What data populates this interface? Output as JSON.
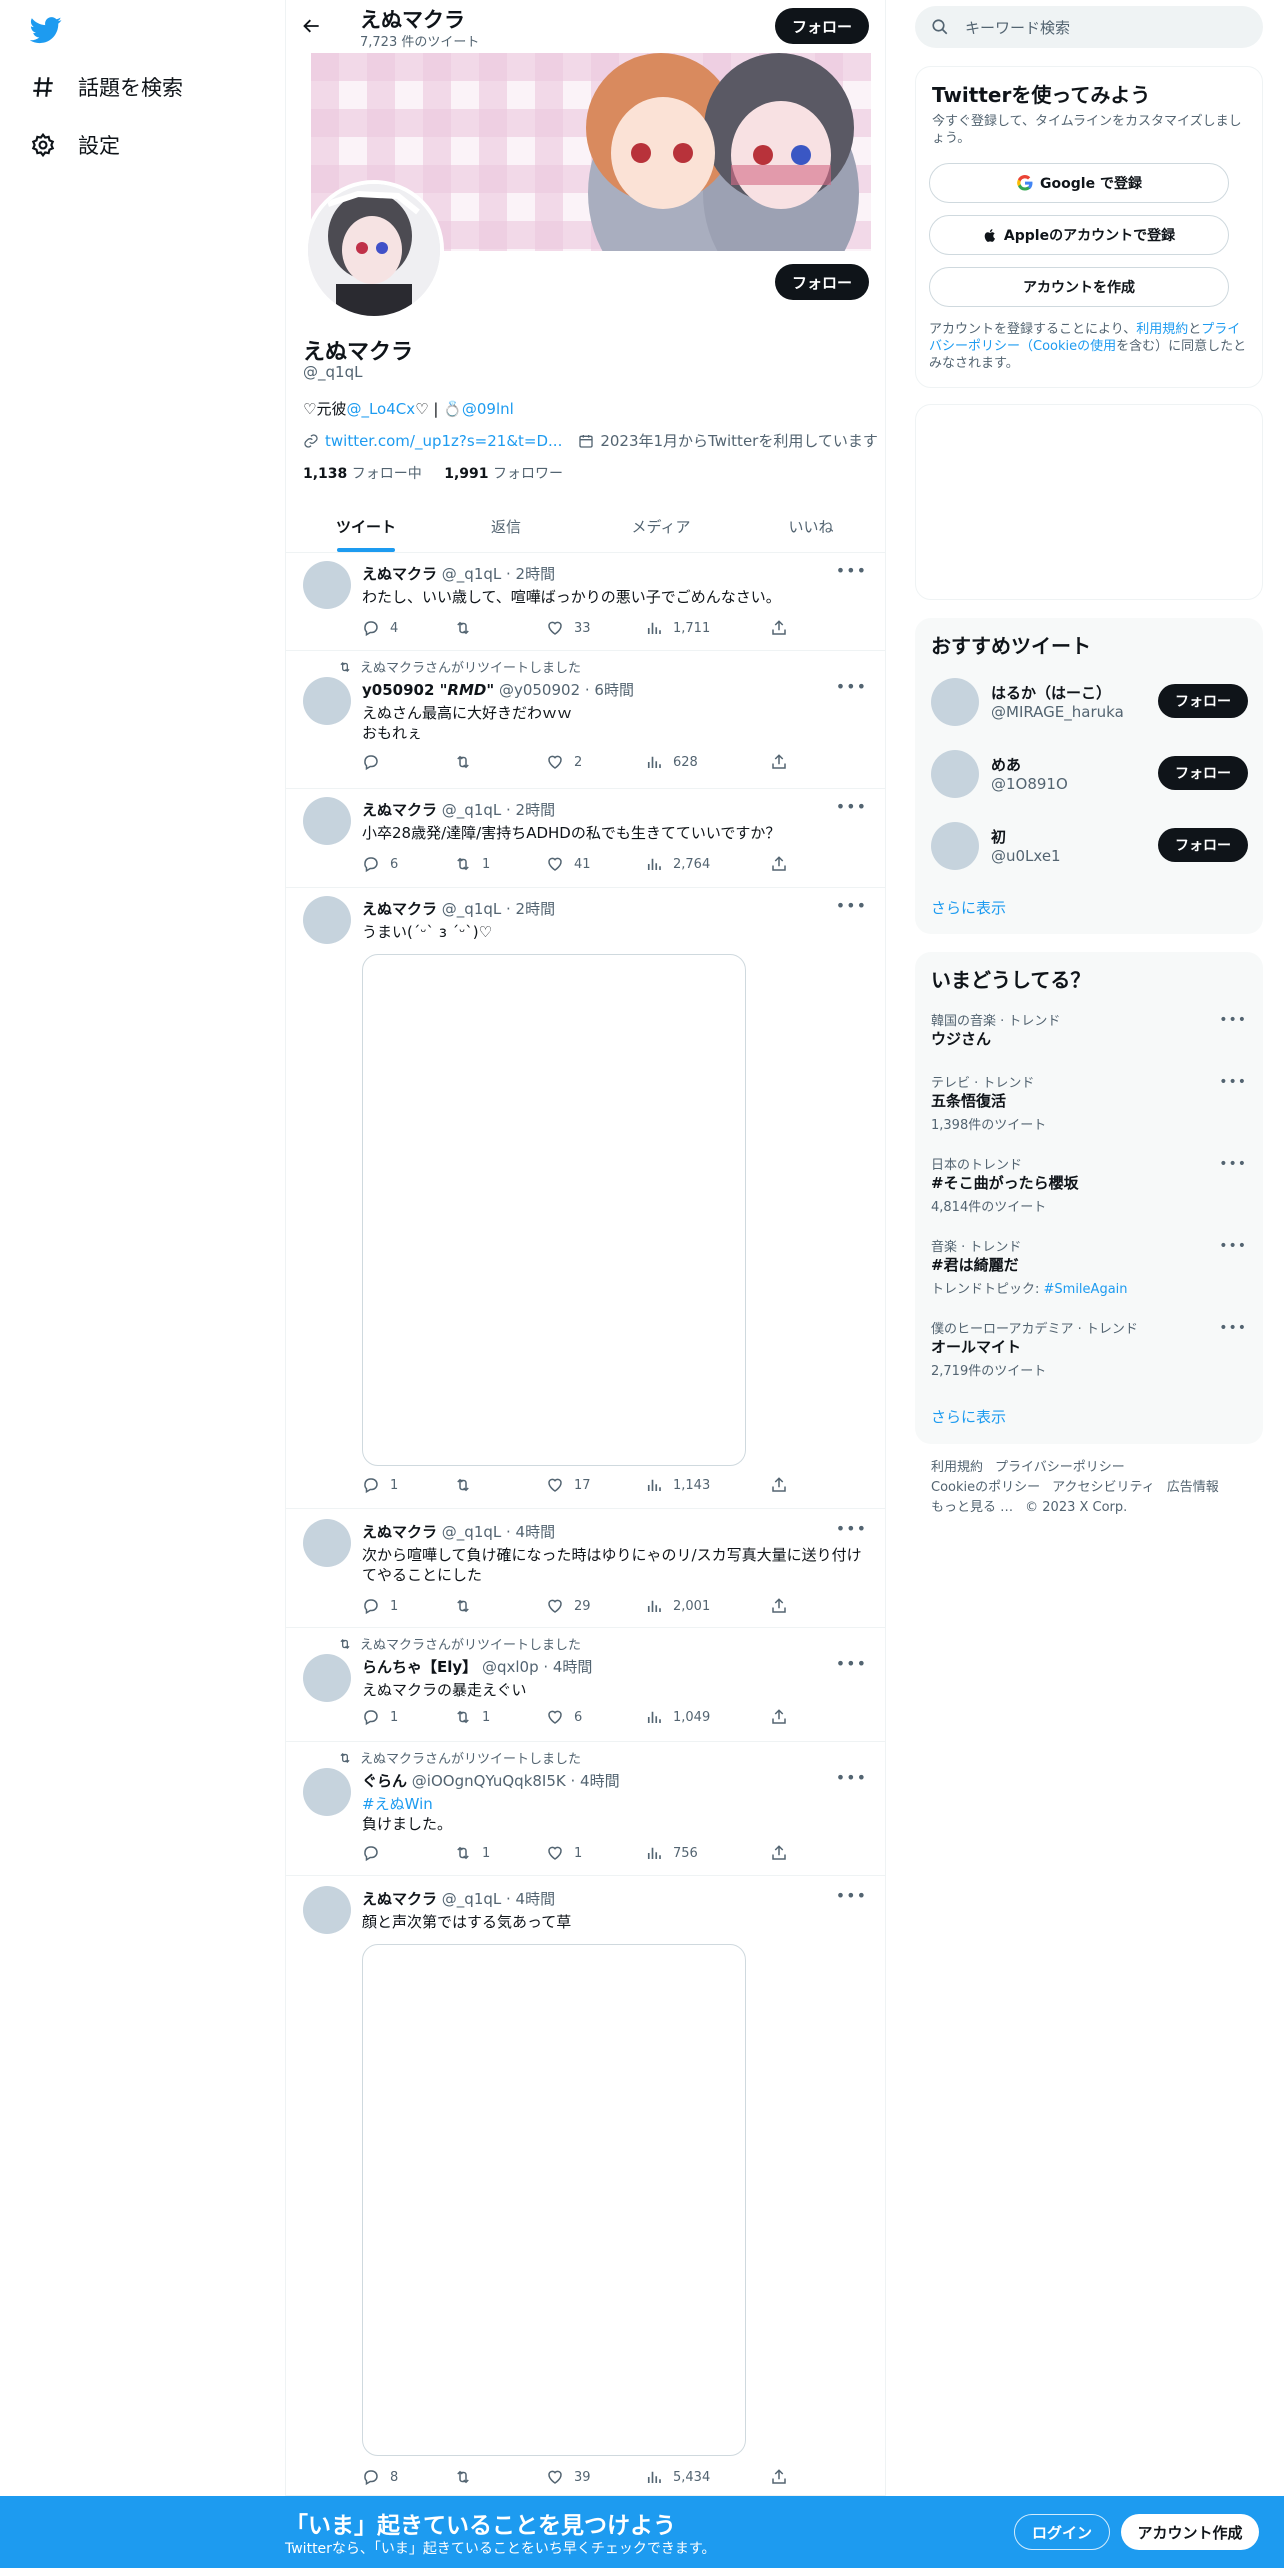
{
  "nav": {
    "logo": "twitter-bird-icon",
    "items": [
      {
        "label": "話題を検索",
        "icon": "hashtag-icon"
      },
      {
        "label": "設定",
        "icon": "gear-icon"
      }
    ]
  },
  "header": {
    "name": "えぬマクラ",
    "tweet_count": "7,723 件のツイート",
    "follow_label": "フォロー"
  },
  "profile": {
    "name": "えぬマクラ",
    "handle": "@_q1qL",
    "follow_label": "フォロー",
    "bio_prefix": "♡元彼",
    "bio_link1": "@_Lo4Cx",
    "bio_middle": "♡ | ",
    "bio_ring": "💍",
    "bio_link2": "@09lnl",
    "website": "twitter.com/_up1z?s=21&t=D...",
    "joined": "2023年1月からTwitterを利用しています",
    "following_count": "1,138",
    "following_label": "フォロー中",
    "followers_count": "1,991",
    "followers_label": "フォロワー"
  },
  "tabs": [
    "ツイート",
    "返信",
    "メディア",
    "いいね"
  ],
  "tweets": [
    {
      "context": "",
      "name": "えぬマクラ",
      "meta": "@_q1qL · 2時間",
      "text": "わたし、いい歳して、喧嘩ばっかりの悪い子でごめんなさい。",
      "reply": "4",
      "retweet": "",
      "like": "33",
      "views": "1,711"
    },
    {
      "context": "えぬマクラさんがリツイートしました",
      "name": "y050902 \"𝙍𝙈𝘿\"",
      "meta": "@y050902 · 6時間",
      "text": "えぬさん最高に大好きだわｗｗ\nおもれぇ",
      "reply": "",
      "retweet": "",
      "like": "2",
      "views": "628"
    },
    {
      "context": "",
      "name": "えぬマクラ",
      "meta": "@_q1qL · 2時間",
      "text": "小卒28歳発/達障/害持ちADHDの私でも生きてていいですか？",
      "reply": "6",
      "retweet": "1",
      "like": "41",
      "views": "2,764"
    },
    {
      "context": "",
      "name": "えぬマクラ",
      "meta": "@_q1qL · 2時間",
      "text": "うまい(ˊᵕˋ з ˊᵕˋ)♡",
      "reply": "1",
      "retweet": "",
      "like": "17",
      "views": "1,143"
    },
    {
      "context": "",
      "name": "えぬマクラ",
      "meta": "@_q1qL · 4時間",
      "text": "次から喧嘩して負け確になった時はゆりにゃのリ/スカ写真大量に送り付けてやることにした",
      "reply": "1",
      "retweet": "",
      "like": "29",
      "views": "2,001"
    },
    {
      "context": "えぬマクラさんがリツイートしました",
      "name": "らんちゃ【Ely】",
      "meta": "@qxl0p · 4時間",
      "text": "えぬマクラの暴走えぐい",
      "reply": "1",
      "retweet": "1",
      "like": "6",
      "views": "1,049"
    },
    {
      "context": "えぬマクラさんがリツイートしました",
      "name": "ぐらん",
      "meta": "@iOOgnQYuQqk8I5K · 4時間",
      "hashtag": "#えぬWin",
      "text": "負けました。",
      "reply": "",
      "retweet": "1",
      "like": "1",
      "views": "756"
    },
    {
      "context": "",
      "name": "えぬマクラ",
      "meta": "@_q1qL · 4時間",
      "text": "顔と声次第ではする気あって草",
      "reply": "8",
      "retweet": "",
      "like": "39",
      "views": "5,434"
    }
  ],
  "search": {
    "placeholder": "キーワード検索"
  },
  "signup": {
    "title": "Twitterを使ってみよう",
    "subtitle": "今すぐ登録して、タイムラインをカスタマイズしましょう。",
    "google": "Google で登録",
    "apple": "Appleのアカウントで登録",
    "create": "アカウントを作成",
    "legal_1": "アカウントを登録することにより、",
    "legal_terms": "利用規約",
    "legal_2": "と",
    "legal_privacy": "プライバシーポリシー（Cookieの使用",
    "legal_3": "を含む）に同意したとみなされます。"
  },
  "recommended": {
    "title": "おすすめツイート",
    "users": [
      {
        "name": "はるか（はーこ）",
        "handle": "@MIRAGE_haruka"
      },
      {
        "name": "めあ",
        "handle": "@1O891O"
      },
      {
        "name": "初",
        "handle": "@u0Lxe1"
      }
    ],
    "follow_label": "フォロー",
    "more": "さらに表示"
  },
  "trends": {
    "title": "いまどうしてる？",
    "items": [
      {
        "category": "韓国の音楽 · トレンド",
        "topic": "ウジさん",
        "count": ""
      },
      {
        "category": "テレビ · トレンド",
        "topic": "五条悟復活",
        "count": "1,398件のツイート"
      },
      {
        "category": "日本のトレンド",
        "topic": "#そこ曲がったら櫻坂",
        "count": "4,814件のツイート"
      },
      {
        "category": "音楽 · トレンド",
        "topic": "#君は綺麗だ",
        "count_prefix": "トレンドトピック: ",
        "count_link": "#SmileAgain"
      },
      {
        "category": "僕のヒーローアカデミア · トレンド",
        "topic": "オールマイト",
        "count": "2,719件のツイート"
      }
    ],
    "more": "さらに表示"
  },
  "footer": [
    "利用規約",
    "プライバシーポリシー",
    "Cookieのポリシー",
    "アクセシビリティ",
    "広告情報",
    "もっと見る …",
    "© 2023 X Corp."
  ],
  "bottom": {
    "title": "「いま」起きていることを見つけよう",
    "subtitle": "Twitterなら、「いま」起きていることをいち早くチェックできます。",
    "login": "ログイン",
    "signup": "アカウント作成"
  },
  "colors": {
    "accent": "#1d9bf0",
    "dark": "#0f1419",
    "muted": "#536471"
  }
}
